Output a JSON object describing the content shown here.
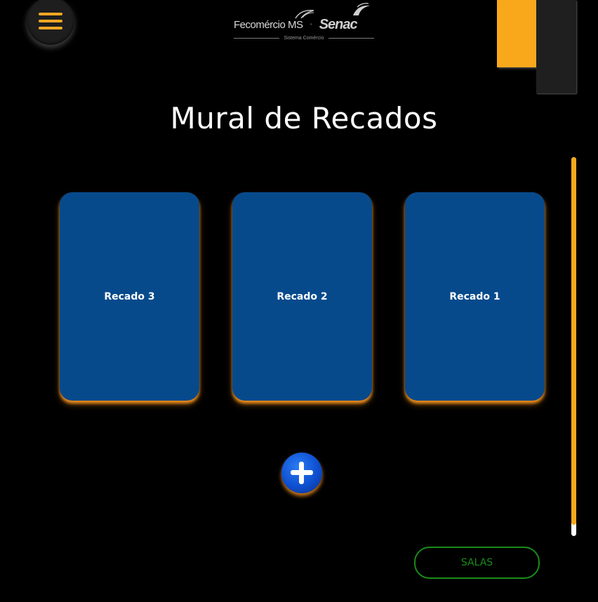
{
  "header": {
    "menu_icon": "hamburger-menu-icon",
    "logo": {
      "brand_primary": "Fecomércio MS",
      "separator": "·",
      "brand_secondary": "Senac",
      "tagline": "Sistema Comércio"
    }
  },
  "main": {
    "title": "Mural de Recados",
    "cards": [
      {
        "label": "Recado 3"
      },
      {
        "label": "Recado 2"
      },
      {
        "label": "Recado 1"
      }
    ],
    "add_icon": "plus-circle-icon"
  },
  "footer": {
    "salas_label": "SALAS"
  },
  "colors": {
    "background": "#000000",
    "accent_orange": "#f9a81b",
    "card_blue": "#074a8c",
    "add_button_blue": "#0e4fd0",
    "salas_green": "#1a8c1a",
    "deco_dark": "#1f1f1f"
  }
}
